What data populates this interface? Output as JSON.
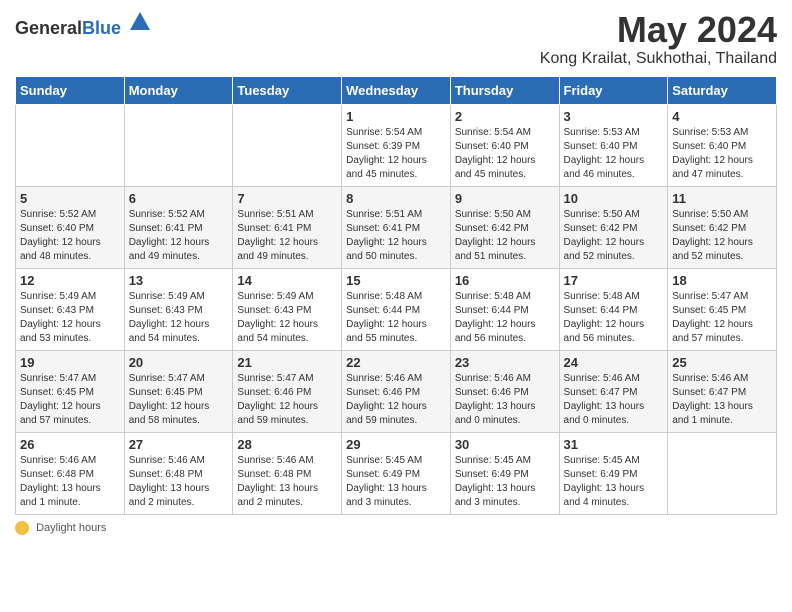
{
  "logo": {
    "general": "General",
    "blue": "Blue"
  },
  "title": "May 2024",
  "subtitle": "Kong Krailat, Sukhothai, Thailand",
  "days_of_week": [
    "Sunday",
    "Monday",
    "Tuesday",
    "Wednesday",
    "Thursday",
    "Friday",
    "Saturday"
  ],
  "footer_label": "Daylight hours",
  "weeks": [
    [
      {
        "day": "",
        "info": ""
      },
      {
        "day": "",
        "info": ""
      },
      {
        "day": "",
        "info": ""
      },
      {
        "day": "1",
        "info": "Sunrise: 5:54 AM\nSunset: 6:39 PM\nDaylight: 12 hours\nand 45 minutes."
      },
      {
        "day": "2",
        "info": "Sunrise: 5:54 AM\nSunset: 6:40 PM\nDaylight: 12 hours\nand 45 minutes."
      },
      {
        "day": "3",
        "info": "Sunrise: 5:53 AM\nSunset: 6:40 PM\nDaylight: 12 hours\nand 46 minutes."
      },
      {
        "day": "4",
        "info": "Sunrise: 5:53 AM\nSunset: 6:40 PM\nDaylight: 12 hours\nand 47 minutes."
      }
    ],
    [
      {
        "day": "5",
        "info": "Sunrise: 5:52 AM\nSunset: 6:40 PM\nDaylight: 12 hours\nand 48 minutes."
      },
      {
        "day": "6",
        "info": "Sunrise: 5:52 AM\nSunset: 6:41 PM\nDaylight: 12 hours\nand 49 minutes."
      },
      {
        "day": "7",
        "info": "Sunrise: 5:51 AM\nSunset: 6:41 PM\nDaylight: 12 hours\nand 49 minutes."
      },
      {
        "day": "8",
        "info": "Sunrise: 5:51 AM\nSunset: 6:41 PM\nDaylight: 12 hours\nand 50 minutes."
      },
      {
        "day": "9",
        "info": "Sunrise: 5:50 AM\nSunset: 6:42 PM\nDaylight: 12 hours\nand 51 minutes."
      },
      {
        "day": "10",
        "info": "Sunrise: 5:50 AM\nSunset: 6:42 PM\nDaylight: 12 hours\nand 52 minutes."
      },
      {
        "day": "11",
        "info": "Sunrise: 5:50 AM\nSunset: 6:42 PM\nDaylight: 12 hours\nand 52 minutes."
      }
    ],
    [
      {
        "day": "12",
        "info": "Sunrise: 5:49 AM\nSunset: 6:43 PM\nDaylight: 12 hours\nand 53 minutes."
      },
      {
        "day": "13",
        "info": "Sunrise: 5:49 AM\nSunset: 6:43 PM\nDaylight: 12 hours\nand 54 minutes."
      },
      {
        "day": "14",
        "info": "Sunrise: 5:49 AM\nSunset: 6:43 PM\nDaylight: 12 hours\nand 54 minutes."
      },
      {
        "day": "15",
        "info": "Sunrise: 5:48 AM\nSunset: 6:44 PM\nDaylight: 12 hours\nand 55 minutes."
      },
      {
        "day": "16",
        "info": "Sunrise: 5:48 AM\nSunset: 6:44 PM\nDaylight: 12 hours\nand 56 minutes."
      },
      {
        "day": "17",
        "info": "Sunrise: 5:48 AM\nSunset: 6:44 PM\nDaylight: 12 hours\nand 56 minutes."
      },
      {
        "day": "18",
        "info": "Sunrise: 5:47 AM\nSunset: 6:45 PM\nDaylight: 12 hours\nand 57 minutes."
      }
    ],
    [
      {
        "day": "19",
        "info": "Sunrise: 5:47 AM\nSunset: 6:45 PM\nDaylight: 12 hours\nand 57 minutes."
      },
      {
        "day": "20",
        "info": "Sunrise: 5:47 AM\nSunset: 6:45 PM\nDaylight: 12 hours\nand 58 minutes."
      },
      {
        "day": "21",
        "info": "Sunrise: 5:47 AM\nSunset: 6:46 PM\nDaylight: 12 hours\nand 59 minutes."
      },
      {
        "day": "22",
        "info": "Sunrise: 5:46 AM\nSunset: 6:46 PM\nDaylight: 12 hours\nand 59 minutes."
      },
      {
        "day": "23",
        "info": "Sunrise: 5:46 AM\nSunset: 6:46 PM\nDaylight: 13 hours\nand 0 minutes."
      },
      {
        "day": "24",
        "info": "Sunrise: 5:46 AM\nSunset: 6:47 PM\nDaylight: 13 hours\nand 0 minutes."
      },
      {
        "day": "25",
        "info": "Sunrise: 5:46 AM\nSunset: 6:47 PM\nDaylight: 13 hours\nand 1 minute."
      }
    ],
    [
      {
        "day": "26",
        "info": "Sunrise: 5:46 AM\nSunset: 6:48 PM\nDaylight: 13 hours\nand 1 minute."
      },
      {
        "day": "27",
        "info": "Sunrise: 5:46 AM\nSunset: 6:48 PM\nDaylight: 13 hours\nand 2 minutes."
      },
      {
        "day": "28",
        "info": "Sunrise: 5:46 AM\nSunset: 6:48 PM\nDaylight: 13 hours\nand 2 minutes."
      },
      {
        "day": "29",
        "info": "Sunrise: 5:45 AM\nSunset: 6:49 PM\nDaylight: 13 hours\nand 3 minutes."
      },
      {
        "day": "30",
        "info": "Sunrise: 5:45 AM\nSunset: 6:49 PM\nDaylight: 13 hours\nand 3 minutes."
      },
      {
        "day": "31",
        "info": "Sunrise: 5:45 AM\nSunset: 6:49 PM\nDaylight: 13 hours\nand 4 minutes."
      },
      {
        "day": "",
        "info": ""
      }
    ]
  ]
}
